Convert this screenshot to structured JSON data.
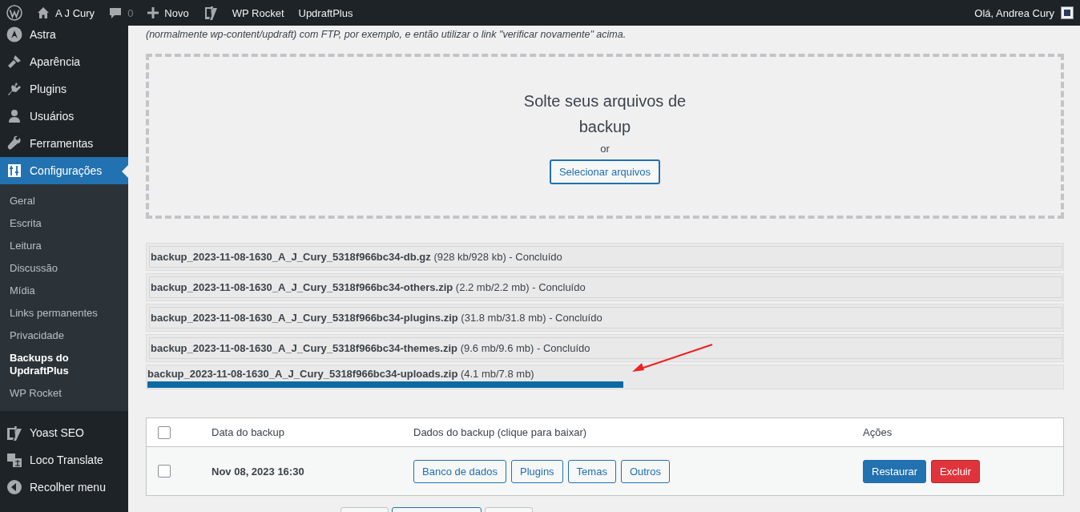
{
  "admin_bar": {
    "site": "A J Cury",
    "comments": "0",
    "new": "Novo",
    "links": [
      "WP Rocket",
      "UpdraftPlus"
    ],
    "greeting": "Olá, Andrea Cury"
  },
  "sidebar": {
    "items": [
      {
        "label": "Astra",
        "selected": false
      },
      {
        "label": "Aparência",
        "selected": false
      },
      {
        "label": "Plugins",
        "selected": false
      },
      {
        "label": "Usuários",
        "selected": false
      },
      {
        "label": "Ferramentas",
        "selected": false
      },
      {
        "label": "Configurações",
        "selected": true
      }
    ],
    "submenu": [
      {
        "label": "Geral",
        "selected": false
      },
      {
        "label": "Escrita",
        "selected": false
      },
      {
        "label": "Leitura",
        "selected": false
      },
      {
        "label": "Discussão",
        "selected": false
      },
      {
        "label": "Mídia",
        "selected": false
      },
      {
        "label": "Links permanentes",
        "selected": false
      },
      {
        "label": "Privacidade",
        "selected": false
      },
      {
        "label": "Backups do UpdraftPlus",
        "selected": true
      },
      {
        "label": "WP Rocket",
        "selected": false
      }
    ],
    "bottom_items": [
      {
        "label": "Yoast SEO",
        "selected": false
      },
      {
        "label": "Loco Translate",
        "selected": false
      },
      {
        "label": "Recolher menu",
        "selected": false
      }
    ]
  },
  "intro_text": "(normalmente wp-content/updraft) com FTP, por exemplo, e então utilizar o link \"verificar novamente\" acima.",
  "dropzone": {
    "title": "Solte seus arquivos de backup",
    "or": "or",
    "button": "Selecionar arquivos"
  },
  "uploads": [
    {
      "text": "**backup_2023-11-08-1630_A_J_Cury_5318f966bc34-db.gz** (928 kb/928 kb) - Concluído",
      "done": true
    },
    {
      "text": "**backup_2023-11-08-1630_A_J_Cury_5318f966bc34-others.zip** (2.2 mb/2.2 mb) - Concluído",
      "done": true
    },
    {
      "text": "**backup_2023-11-08-1630_A_J_Cury_5318f966bc34-plugins.zip** (31.8 mb/31.8 mb) - Concluído",
      "done": true
    },
    {
      "text": "**backup_2023-11-08-1630_A_J_Cury_5318f966bc34-themes.zip** (9.6 mb/9.6 mb) - Concluído",
      "done": true
    },
    {
      "text": "**backup_2023-11-08-1630_A_J_Cury_5318f966bc34-uploads.zip** (4.1 mb/7.8 mb)",
      "done": false,
      "level": 0.52
    }
  ],
  "table": {
    "columns": [
      "Data do backup",
      "Dados do backup (clique para baixar)",
      "Ações"
    ],
    "rows": [
      {
        "checked": false,
        "date": "Nov 08, 2023 16:30",
        "data_buttons": [
          "Banco de dados",
          "Plugins",
          "Temas",
          "Outros"
        ],
        "actions": [
          {
            "label": "Restaurar",
            "kind": "primary"
          },
          {
            "label": "Excluir",
            "kind": "danger"
          }
        ]
      }
    ],
    "header_checked": false
  }
}
